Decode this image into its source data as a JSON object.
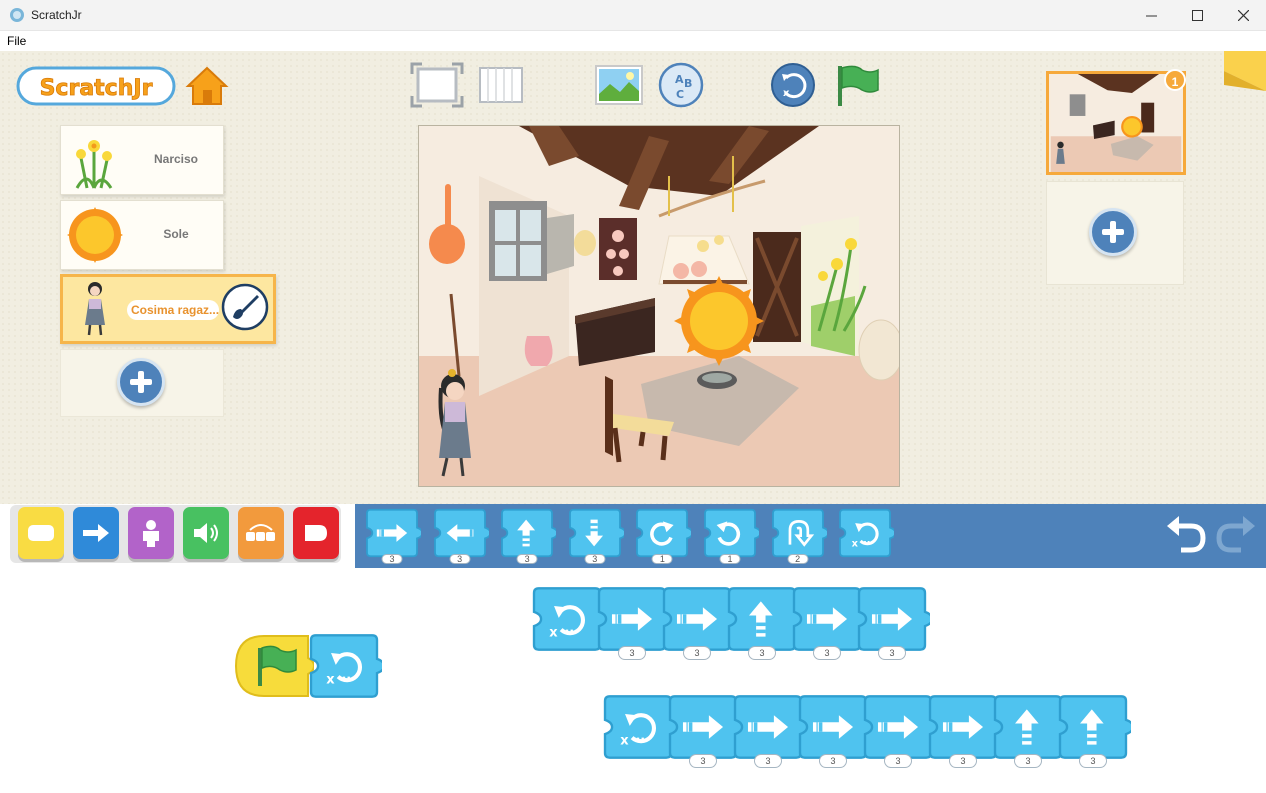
{
  "window": {
    "title": "ScratchJr",
    "menu": [
      "File"
    ]
  },
  "header": {
    "logo_text": "ScratchJr",
    "home": "home-icon"
  },
  "top_tools": [
    "fullscreen-icon",
    "grid-icon",
    "background-icon",
    "text-icon",
    "reset-icon",
    "green-flag-icon"
  ],
  "sprites": [
    {
      "name": "Narciso",
      "selected": false
    },
    {
      "name": "Sole",
      "selected": false
    },
    {
      "name": "Cosima ragaz...",
      "selected": true
    }
  ],
  "pages": {
    "current": "1"
  },
  "categories": [
    "triggering",
    "motion",
    "looks",
    "sound",
    "control",
    "end"
  ],
  "palette": [
    {
      "icon": "move-right",
      "value": "3"
    },
    {
      "icon": "move-left",
      "value": "3"
    },
    {
      "icon": "move-up",
      "value": "3"
    },
    {
      "icon": "move-down",
      "value": "3"
    },
    {
      "icon": "turn-right",
      "value": "1"
    },
    {
      "icon": "turn-left",
      "value": "1"
    },
    {
      "icon": "hop",
      "value": "2"
    },
    {
      "icon": "go-home",
      "value": ""
    }
  ],
  "scripts": {
    "script1": [
      {
        "icon": "go-home",
        "value": ""
      },
      {
        "icon": "move-right",
        "value": "3"
      },
      {
        "icon": "move-right",
        "value": "3"
      },
      {
        "icon": "move-up",
        "value": "3"
      },
      {
        "icon": "move-right",
        "value": "3"
      },
      {
        "icon": "move-right",
        "value": "3"
      }
    ],
    "script2": [
      {
        "icon": "go-home",
        "value": ""
      },
      {
        "icon": "move-right",
        "value": "3"
      },
      {
        "icon": "move-right",
        "value": "3"
      },
      {
        "icon": "move-right",
        "value": "3"
      },
      {
        "icon": "move-right",
        "value": "3"
      },
      {
        "icon": "move-right",
        "value": "3"
      },
      {
        "icon": "move-up",
        "value": "3"
      },
      {
        "icon": "move-up",
        "value": "3"
      }
    ]
  },
  "colors": {
    "motion": "#4fc3ef",
    "palette_bg": "#4e82ba",
    "trigger": "#f7dc3b",
    "selection": "#f6b54a"
  }
}
